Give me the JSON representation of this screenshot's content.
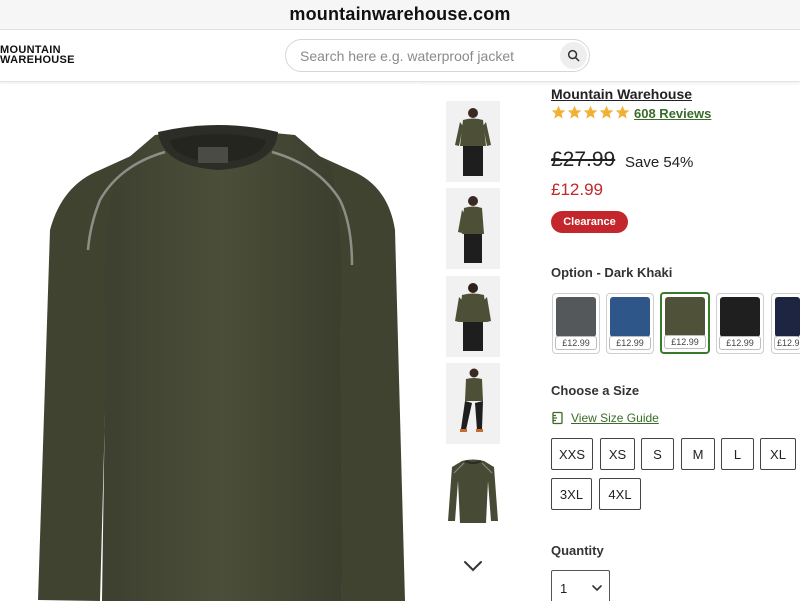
{
  "browser": {
    "url": "mountainwarehouse.com"
  },
  "header": {
    "logo_line1": "MOUNTAIN",
    "logo_line2": "WAREHOUSE",
    "search_placeholder": "Search here e.g. waterproof jacket"
  },
  "product": {
    "brand": "Mountain Warehouse",
    "rating": 5,
    "reviews": "608 Reviews",
    "was_price": "£27.99",
    "save": "Save 54%",
    "now_price": "£12.99",
    "badge": "Clearance",
    "option_label": "Option - Dark Khaki",
    "swatches": [
      {
        "price": "£12.99",
        "color": "#55585b"
      },
      {
        "price": "£12.99",
        "color": "#2e5689"
      },
      {
        "price": "£12.99",
        "color": "#4f5238"
      },
      {
        "price": "£12.99",
        "color": "#1f1f20"
      },
      {
        "price": "£12.9",
        "color": "#1e2540"
      }
    ],
    "selected_swatch": 2,
    "size_label": "Choose a Size",
    "size_guide": "View Size Guide",
    "sizes": [
      "XXS",
      "XS",
      "S",
      "M",
      "L",
      "XL",
      "3XL",
      "4XL"
    ],
    "quantity_label": "Quantity",
    "quantity": "1"
  },
  "colors": {
    "accent_red": "#c3272b",
    "accent_green": "#3a6b2a",
    "star": "#f2b134",
    "garment": "#474a35"
  },
  "icons": {
    "search": "search-icon",
    "chevron_down": "chevron-down-icon",
    "size_guide": "ruler-icon",
    "star": "star-icon"
  }
}
